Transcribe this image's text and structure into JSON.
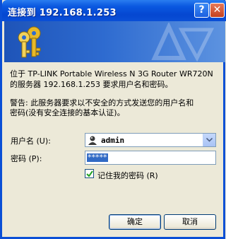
{
  "window": {
    "title": "连接到 192.168.1.253",
    "help_label": "?",
    "close_label": "✕"
  },
  "message": {
    "line1": "位于 TP-LINK Portable Wireless N 3G Router WR720N",
    "line2": "的服务器 192.168.1.253 要求用户名和密码。",
    "warning1": "警告: 此服务器要求以不安全的方式发送您的用户名和",
    "warning2": "密码(没有安全连接的基本认证)。"
  },
  "form": {
    "username_label": "用户名",
    "username_hotkey": "(U):",
    "username_value": "admin",
    "password_label": "密码",
    "password_hotkey": "(P):",
    "password_value": "*****",
    "remember_label": "记住我的密码",
    "remember_hotkey": "(R)",
    "remember_checked": true
  },
  "buttons": {
    "ok": "确定",
    "cancel": "取消"
  },
  "icons": {
    "banner": "keys-icon",
    "user": "user-avatar-icon",
    "dropdown": "chevron-down-icon",
    "check": "checkmark-icon"
  },
  "colors": {
    "titlebar": "#0a58e0",
    "selection": "#316ac5"
  }
}
